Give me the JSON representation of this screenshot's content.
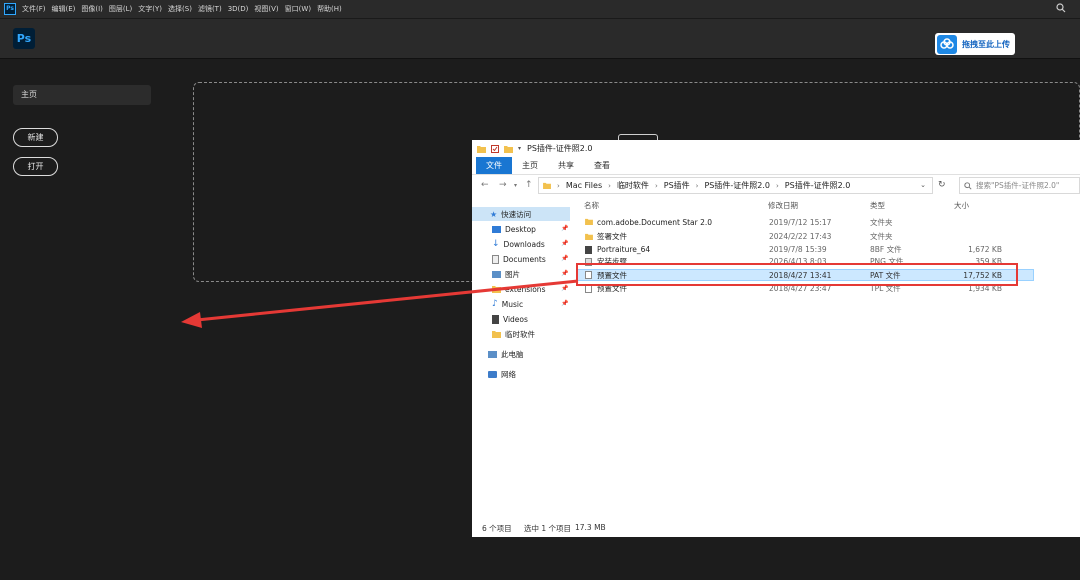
{
  "menubar": {
    "logo": "Ps",
    "items": [
      "文件(F)",
      "编辑(E)",
      "图像(I)",
      "图层(L)",
      "文字(Y)",
      "选择(S)",
      "滤镜(T)",
      "3D(D)",
      "视图(V)",
      "窗口(W)",
      "帮助(H)"
    ]
  },
  "header": {
    "logo": "Ps",
    "upload_button": "拖拽至此上传",
    "upload_icon": "cloud-upload-icon"
  },
  "sidebar": {
    "home": "主页",
    "new_button": "新建",
    "open_button": "打开"
  },
  "explorer": {
    "title": "PS插件-证件照2.0",
    "ribbon": [
      "文件",
      "主页",
      "共享",
      "查看"
    ],
    "breadcrumb": [
      "Mac Files",
      "临时软件",
      "PS插件",
      "PS插件-证件照2.0",
      "PS插件-证件照2.0"
    ],
    "search_placeholder": "搜索\"PS插件-证件照2.0\"",
    "nav": {
      "quick_access": "快速访问",
      "items": [
        "Desktop",
        "Downloads",
        "Documents",
        "图片",
        "extensions",
        "Music",
        "Videos",
        "临时软件"
      ],
      "this_pc": "此电脑",
      "network": "网络"
    },
    "columns": {
      "name": "名称",
      "date": "修改日期",
      "type": "类型",
      "size": "大小"
    },
    "files": [
      {
        "name": "com.adobe.Document Star 2.0",
        "date": "2019/7/12 15:17",
        "type": "文件夹",
        "size": ""
      },
      {
        "name": "签署文件",
        "date": "2024/2/22 17:43",
        "type": "文件夹",
        "size": ""
      },
      {
        "name": "Portraiture_64",
        "date": "2019/7/8 15:39",
        "type": "8BF 文件",
        "size": "1,672 KB"
      },
      {
        "name": "安装步骤",
        "date": "2026/4/13 8:03",
        "type": "PNG 文件",
        "size": "359 KB"
      },
      {
        "name": "预置文件",
        "date": "2018/4/27 13:41",
        "type": "PAT 文件",
        "size": "17,752 KB"
      },
      {
        "name": "预置文件",
        "date": "2018/4/27 23:47",
        "type": "TPL 文件",
        "size": "1,934 KB"
      }
    ],
    "status": {
      "count": "6 个项目",
      "selected": "选中 1 个项目",
      "size": "17.3 MB"
    }
  },
  "colors": {
    "annotation": "#e53935",
    "ps_blue": "#31a8ff",
    "selection": "#cce8ff"
  }
}
